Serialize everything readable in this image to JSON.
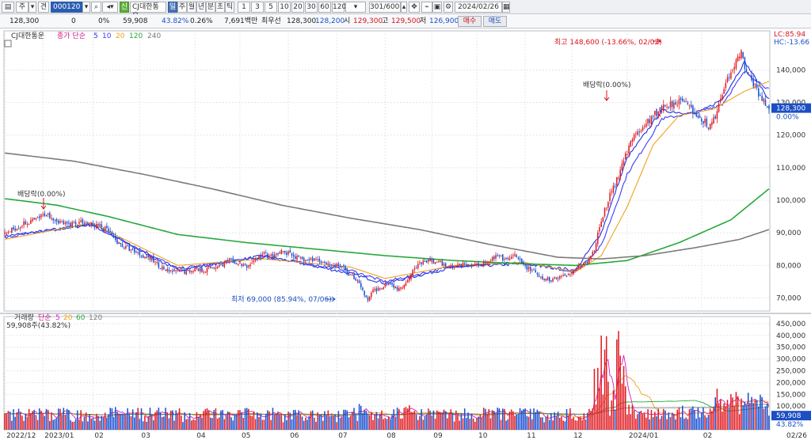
{
  "toolbar": {
    "item_label": "주",
    "kind_label": "견",
    "code": "000120",
    "search_icon": "search-icon",
    "tag": "신",
    "stock_name": "CJ대한통운",
    "periods": [
      "일",
      "주",
      "월",
      "년",
      "분",
      "초",
      "틱"
    ],
    "active_period": "일",
    "intervals": [
      "1",
      "3",
      "5",
      "10",
      "20",
      "30",
      "60",
      "120"
    ],
    "count": "301",
    "count_total": "/600",
    "date": "2024/02/26"
  },
  "quote": {
    "price": "128,300",
    "change": "0",
    "change_rate": "0%",
    "volume": "59,908",
    "volume_ratio": "43.82%",
    "turnover": "0.26%",
    "amount": "7,691백만",
    "best_label": "최우선",
    "best_ask": "128,300",
    "best_bid": "128,200",
    "open_label": "시",
    "open": "129,300",
    "high_label": "고",
    "high": "129,500",
    "low_label": "저",
    "low": "126,900",
    "buy_label": "매수",
    "sell_label": "매도"
  },
  "price_panel": {
    "legend_name": "CJ대한통운",
    "legend_type": "종가 단순",
    "ma_labels": [
      "5",
      "10",
      "20",
      "120",
      "240"
    ],
    "ma_colors": [
      "#1f33e0",
      "#3c3cff",
      "#f0a21c",
      "#26a83a",
      "#7a7a7a"
    ],
    "lc": "LC:85.94",
    "hc": "HC:-13.66",
    "last_price_tag": "128,300",
    "last_pct_tag": "0.00%",
    "high_annotation": "최고 148,600 (-13.66%, 02/02)",
    "low_annotation": "최저 69,000 (85.94%, 07/06)",
    "dividend_label_1": "배당락(0.00%)",
    "dividend_label_2": "배당락(0.00%)"
  },
  "volume_panel": {
    "legend": "거래량",
    "legend_type": "단순",
    "ma_labels": [
      "5",
      "20",
      "60",
      "120"
    ],
    "ma_colors": [
      "#d81bbf",
      "#f0a21c",
      "#26a83a",
      "#7a7a7a"
    ],
    "current": "59,908주(43.82%)",
    "last_tag": "59,908",
    "last_pct_tag": "43.82%"
  },
  "x_axis": {
    "labels": [
      "2022/12",
      "2023/01",
      "02",
      "03",
      "04",
      "05",
      "06",
      "07",
      "08",
      "09",
      "10",
      "11",
      "12",
      "2024/01",
      "02"
    ],
    "end_label": "02/26"
  },
  "colors": {
    "up": "#e01b22",
    "down": "#1a4fd0",
    "panel_bg": "#ffffff"
  },
  "chart_data": {
    "type": "candlestick",
    "price_axis": {
      "ticks": [
        70000,
        80000,
        90000,
        100000,
        110000,
        120000,
        130000,
        140000
      ],
      "ylim": [
        66000,
        152000
      ]
    },
    "volume_axis": {
      "ticks": [
        50000,
        100000,
        150000,
        200000,
        250000,
        300000,
        350000,
        400000,
        450000
      ],
      "ylim": [
        0,
        480000
      ]
    },
    "period": [
      "2022/12",
      "2024/02/26"
    ],
    "price_path": [
      [
        0,
        89500
      ],
      [
        6,
        91500
      ],
      [
        12,
        93000
      ],
      [
        18,
        94000
      ],
      [
        24,
        96000
      ],
      [
        30,
        94000
      ],
      [
        35,
        92500
      ],
      [
        40,
        93000
      ],
      [
        45,
        93500
      ],
      [
        50,
        92500
      ],
      [
        55,
        92000
      ],
      [
        60,
        90500
      ],
      [
        65,
        87000
      ],
      [
        70,
        85500
      ],
      [
        75,
        84500
      ],
      [
        80,
        83000
      ],
      [
        85,
        82000
      ],
      [
        90,
        79500
      ],
      [
        95,
        78000
      ],
      [
        100,
        78500
      ],
      [
        105,
        78000
      ],
      [
        110,
        79000
      ],
      [
        115,
        78500
      ],
      [
        120,
        79500
      ],
      [
        125,
        80000
      ],
      [
        130,
        81500
      ],
      [
        135,
        80500
      ],
      [
        140,
        79500
      ],
      [
        145,
        82000
      ],
      [
        150,
        83500
      ],
      [
        155,
        82500
      ],
      [
        160,
        84000
      ],
      [
        165,
        83500
      ],
      [
        170,
        82000
      ],
      [
        175,
        81500
      ],
      [
        180,
        82000
      ],
      [
        185,
        81000
      ],
      [
        190,
        80000
      ],
      [
        195,
        79500
      ],
      [
        200,
        77000
      ],
      [
        205,
        75000
      ],
      [
        208,
        70500
      ],
      [
        210,
        69500
      ],
      [
        213,
        72000
      ],
      [
        218,
        73500
      ],
      [
        222,
        75000
      ],
      [
        228,
        72500
      ],
      [
        232,
        75000
      ],
      [
        236,
        78500
      ],
      [
        240,
        80500
      ],
      [
        245,
        81500
      ],
      [
        250,
        81000
      ],
      [
        255,
        80000
      ],
      [
        260,
        79500
      ],
      [
        265,
        80500
      ],
      [
        270,
        80000
      ],
      [
        275,
        80500
      ],
      [
        280,
        81500
      ],
      [
        285,
        83000
      ],
      [
        290,
        81500
      ],
      [
        295,
        83000
      ],
      [
        300,
        80000
      ],
      [
        305,
        78500
      ],
      [
        310,
        76000
      ],
      [
        315,
        75500
      ],
      [
        320,
        76500
      ],
      [
        325,
        77000
      ],
      [
        330,
        79000
      ],
      [
        335,
        80500
      ],
      [
        338,
        81500
      ],
      [
        341,
        85000
      ],
      [
        344,
        92000
      ],
      [
        347,
        97000
      ],
      [
        350,
        101500
      ],
      [
        353,
        105000
      ],
      [
        356,
        109000
      ],
      [
        360,
        115000
      ],
      [
        364,
        120500
      ],
      [
        368,
        121500
      ],
      [
        372,
        124000
      ],
      [
        376,
        126500
      ],
      [
        380,
        128500
      ],
      [
        384,
        129500
      ],
      [
        388,
        130000
      ],
      [
        392,
        131500
      ],
      [
        396,
        128500
      ],
      [
        400,
        126000
      ],
      [
        404,
        124500
      ],
      [
        408,
        122500
      ],
      [
        412,
        127500
      ],
      [
        416,
        134000
      ],
      [
        420,
        139500
      ],
      [
        424,
        143500
      ],
      [
        426,
        146000
      ],
      [
        428,
        140500
      ],
      [
        432,
        136500
      ],
      [
        436,
        133000
      ],
      [
        440,
        129500
      ],
      [
        442,
        128300
      ]
    ],
    "volume_series": [
      {
        "name": "거래량",
        "unit": "주",
        "last": 59908
      }
    ],
    "moving_averages": [
      {
        "name": "5",
        "path": [
          [
            0,
            89000
          ],
          [
            50,
            92500
          ],
          [
            100,
            78500
          ],
          [
            150,
            83000
          ],
          [
            200,
            77500
          ],
          [
            220,
            74500
          ],
          [
            260,
            79500
          ],
          [
            300,
            80500
          ],
          [
            330,
            78500
          ],
          [
            345,
            90000
          ],
          [
            360,
            113000
          ],
          [
            380,
            127500
          ],
          [
            400,
            126500
          ],
          [
            415,
            131000
          ],
          [
            428,
            142500
          ],
          [
            442,
            131000
          ]
        ]
      },
      {
        "name": "10",
        "path": [
          [
            0,
            88500
          ],
          [
            50,
            92800
          ],
          [
            100,
            79000
          ],
          [
            150,
            82500
          ],
          [
            200,
            78500
          ],
          [
            220,
            75000
          ],
          [
            260,
            79800
          ],
          [
            300,
            80800
          ],
          [
            330,
            78000
          ],
          [
            345,
            86000
          ],
          [
            360,
            108000
          ],
          [
            380,
            125000
          ],
          [
            400,
            127000
          ],
          [
            415,
            129500
          ],
          [
            428,
            139500
          ],
          [
            442,
            134000
          ]
        ]
      },
      {
        "name": "20",
        "path": [
          [
            0,
            88000
          ],
          [
            50,
            93000
          ],
          [
            100,
            80000
          ],
          [
            150,
            82000
          ],
          [
            200,
            79500
          ],
          [
            220,
            76000
          ],
          [
            260,
            80000
          ],
          [
            300,
            81000
          ],
          [
            330,
            78000
          ],
          [
            345,
            83000
          ],
          [
            360,
            98000
          ],
          [
            375,
            117000
          ],
          [
            390,
            126000
          ],
          [
            410,
            128000
          ],
          [
            428,
            133500
          ],
          [
            442,
            136500
          ]
        ]
      },
      {
        "name": "120",
        "path": [
          [
            0,
            100500
          ],
          [
            30,
            98500
          ],
          [
            60,
            95000
          ],
          [
            100,
            89500
          ],
          [
            140,
            87000
          ],
          [
            180,
            85000
          ],
          [
            220,
            83000
          ],
          [
            260,
            81500
          ],
          [
            300,
            80500
          ],
          [
            330,
            80000
          ],
          [
            360,
            81500
          ],
          [
            390,
            87000
          ],
          [
            420,
            94000
          ],
          [
            442,
            103500
          ]
        ]
      },
      {
        "name": "240",
        "path": [
          [
            0,
            114500
          ],
          [
            40,
            112000
          ],
          [
            80,
            108000
          ],
          [
            120,
            103500
          ],
          [
            160,
            98500
          ],
          [
            200,
            94500
          ],
          [
            240,
            91000
          ],
          [
            280,
            86500
          ],
          [
            320,
            82500
          ],
          [
            345,
            82000
          ],
          [
            370,
            83000
          ],
          [
            400,
            85500
          ],
          [
            425,
            88000
          ],
          [
            442,
            91000
          ]
        ]
      }
    ]
  }
}
